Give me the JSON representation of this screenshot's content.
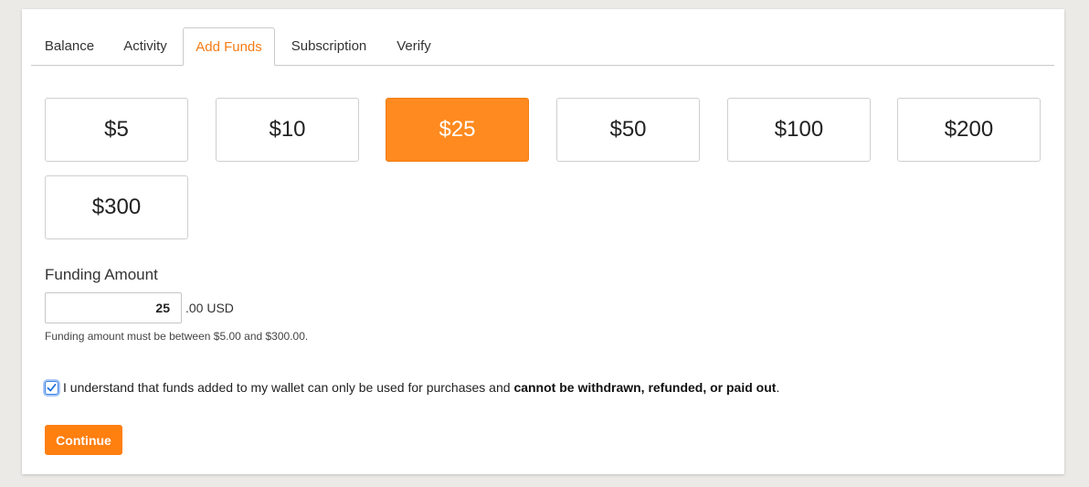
{
  "tabs": [
    {
      "label": "Balance"
    },
    {
      "label": "Activity"
    },
    {
      "label": "Add Funds",
      "active": true
    },
    {
      "label": "Subscription"
    },
    {
      "label": "Verify"
    }
  ],
  "amounts": [
    {
      "label": "$5"
    },
    {
      "label": "$10"
    },
    {
      "label": "$25",
      "selected": true
    },
    {
      "label": "$50"
    },
    {
      "label": "$100"
    },
    {
      "label": "$200"
    },
    {
      "label": "$300"
    }
  ],
  "funding": {
    "label": "Funding Amount",
    "value": "25",
    "suffix": ".00 USD",
    "hint": "Funding amount must be between $5.00 and $300.00."
  },
  "agreement": {
    "checked": true,
    "text": "I understand that funds added to my wallet can only be used for purchases and ",
    "bold": "cannot be withdrawn, refunded, or paid out",
    "end": "."
  },
  "continue_label": "Continue",
  "colors": {
    "accent": "#ff7f0f",
    "active_tab_text": "#f57c14",
    "background": "#ebeae6"
  }
}
